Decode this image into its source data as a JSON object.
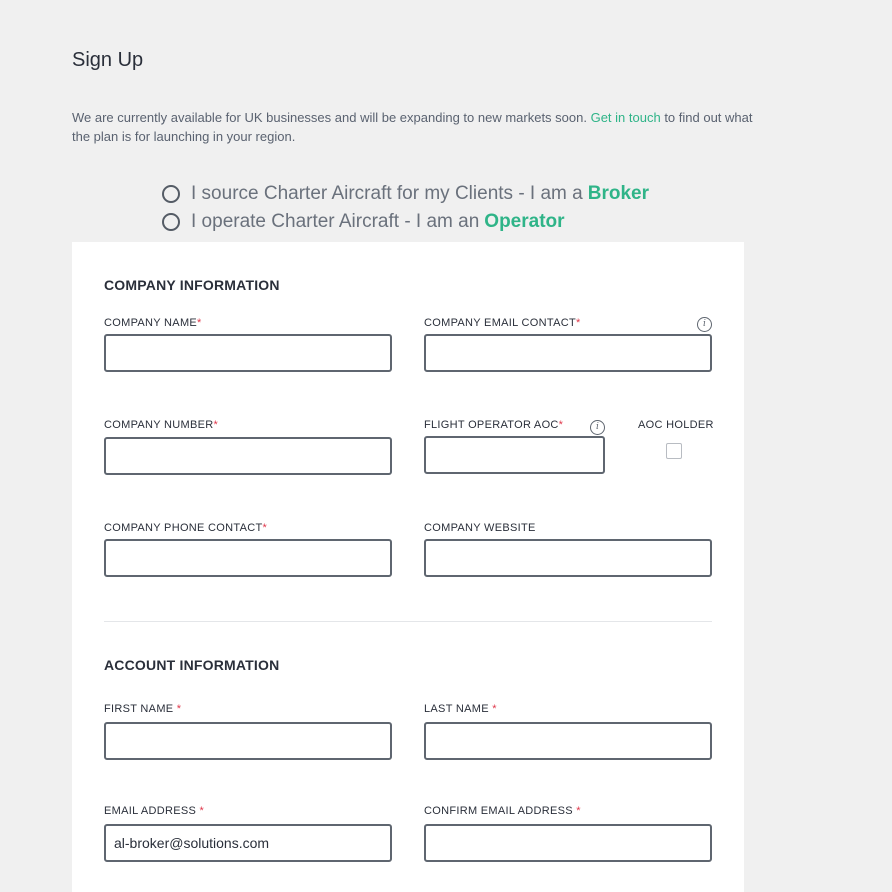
{
  "page": {
    "title": "Sign Up",
    "intro_before": "We are currently available for UK businesses and will be expanding to new markets soon. ",
    "intro_link": "Get in touch",
    "intro_after": " to find out what the plan is for launching in your region."
  },
  "roles": [
    {
      "text": "I source Charter Aircraft for my Clients - I am a",
      "highlight": "Broker",
      "selected": false
    },
    {
      "text": "I operate Charter Aircraft - I am an",
      "highlight": "Operator",
      "selected": false
    }
  ],
  "company": {
    "section_title": "COMPANY INFORMATION",
    "name_label": "COMPANY NAME",
    "email_label": "COMPANY EMAIL CONTACT",
    "number_label": "COMPANY NUMBER",
    "aoc_label": "FLIGHT OPERATOR AOC",
    "aoc_holder_label": "AOC HOLDER",
    "aoc_holder_checked": false,
    "phone_label": "COMPANY PHONE CONTACT",
    "website_label": "COMPANY WEBSITE",
    "required_mark": "*"
  },
  "account": {
    "section_title": "ACCOUNT INFORMATION",
    "first_name_label": "FIRST NAME ",
    "last_name_label": "LAST NAME ",
    "email_label": "EMAIL ADDRESS ",
    "confirm_email_label": "CONFIRM EMAIL ADDRESS ",
    "email_value": "al-broker@solutions.com",
    "required_mark": "*"
  },
  "icons": {
    "info": "i"
  },
  "colors": {
    "accent": "#2fb488",
    "required": "#e0384b",
    "background": "#f0f0f0",
    "card": "#ffffff"
  }
}
